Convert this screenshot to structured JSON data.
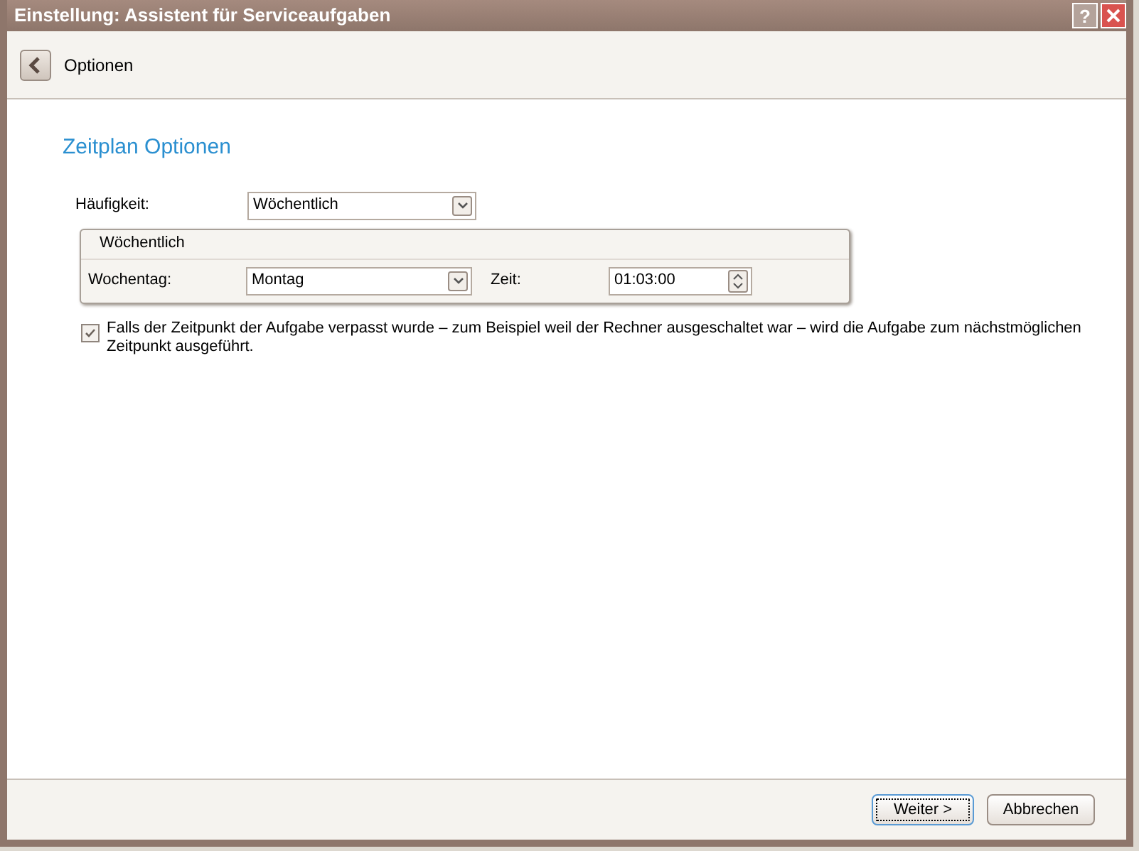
{
  "window": {
    "title": "Einstellung: Assistent für Serviceaufgaben",
    "help": "?"
  },
  "nav": {
    "title": "Optionen"
  },
  "heading": "Zeitplan Optionen",
  "frequency": {
    "label": "Häufigkeit:",
    "value": "Wöchentlich"
  },
  "group": {
    "title": "Wöchentlich",
    "weekday": {
      "label": "Wochentag:",
      "value": "Montag"
    },
    "time": {
      "label": "Zeit:",
      "value": "01:03:00"
    }
  },
  "missed_task": {
    "checked": true,
    "text": "Falls der Zeitpunkt der Aufgabe verpasst wurde – zum Beispiel weil der Rechner ausgeschaltet war – wird die Aufgabe zum nächstmöglichen Zeitpunkt ausgeführt."
  },
  "buttons": [
    {
      "label": "Weiter >",
      "focused": true
    },
    {
      "label": "Abbrechen",
      "focused": false
    }
  ]
}
